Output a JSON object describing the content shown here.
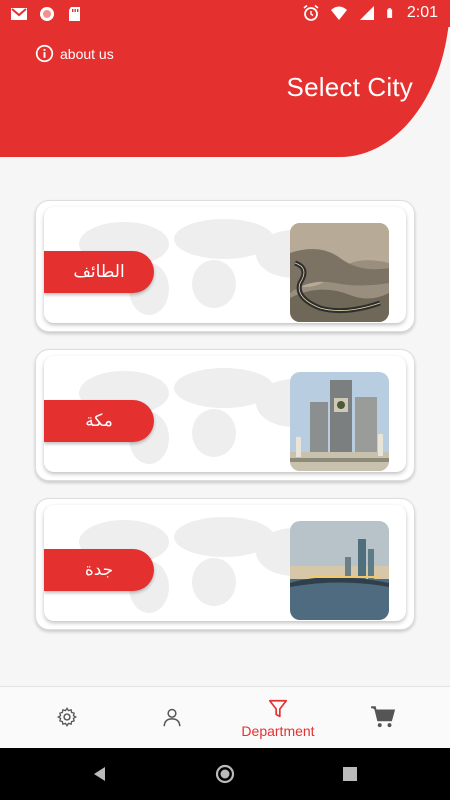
{
  "status_bar": {
    "time": "2:01",
    "icons": [
      "gmail-icon",
      "record-icon",
      "sd-card-icon",
      "alarm-icon",
      "wifi-icon",
      "signal-icon",
      "battery-icon"
    ]
  },
  "header": {
    "about_label": "about us",
    "title": "Select City"
  },
  "cities": [
    {
      "name": "الطائف",
      "image": "mountain-road-image"
    },
    {
      "name": "مكة",
      "image": "clock-tower-image"
    },
    {
      "name": "جدة",
      "image": "jeddah-skyline-image"
    }
  ],
  "bottom_nav": {
    "items": [
      {
        "icon": "settings-icon",
        "label": ""
      },
      {
        "icon": "profile-icon",
        "label": ""
      },
      {
        "icon": "filter-icon",
        "label": "Department",
        "active": true
      },
      {
        "icon": "cart-icon",
        "label": ""
      }
    ]
  },
  "colors": {
    "accent": "#e53030",
    "background": "#f6f6f6"
  }
}
